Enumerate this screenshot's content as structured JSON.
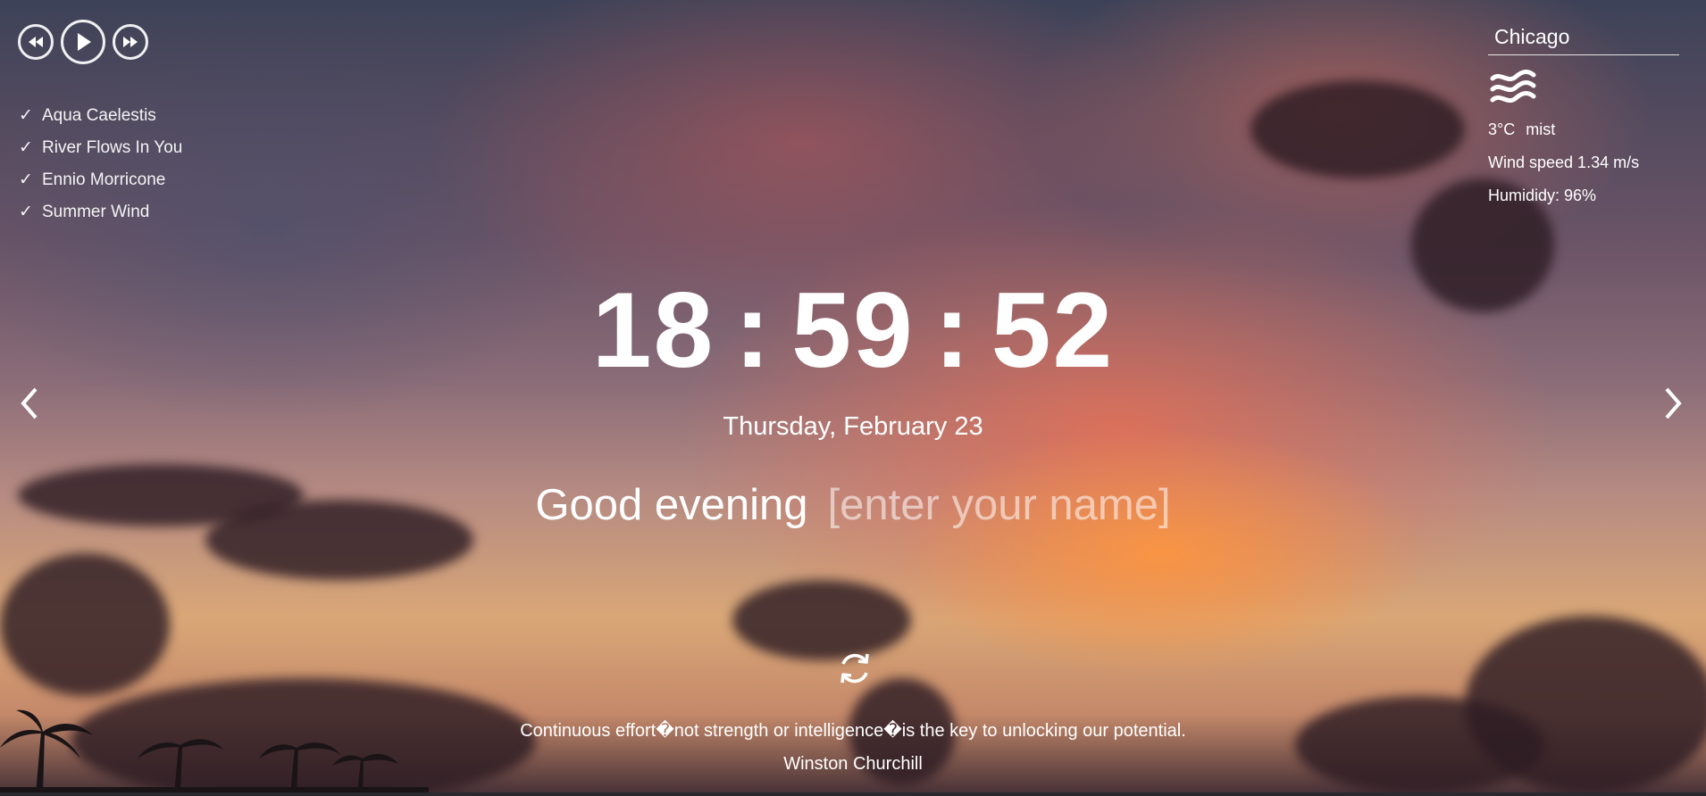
{
  "player": {
    "prev_icon": "rewind-icon",
    "play_icon": "play-icon",
    "next_icon": "fast-forward-icon"
  },
  "playlist": [
    {
      "title": "Aqua Caelestis",
      "icon": "check-icon"
    },
    {
      "title": "River Flows In You",
      "icon": "check-icon"
    },
    {
      "title": "Ennio Morricone",
      "icon": "check-icon"
    },
    {
      "title": "Summer Wind",
      "icon": "check-icon"
    }
  ],
  "weather": {
    "city": "Chicago",
    "icon": "mist-icon",
    "temperature": "3°C",
    "description": "mist",
    "wind": "Wind speed 1.34 m/s",
    "humidity": "Humididy: 96%"
  },
  "clock": {
    "hours": "18",
    "minutes": "59",
    "seconds": "52",
    "separator": ":"
  },
  "date": "Thursday, February 23",
  "greeting": {
    "text": "Good evening",
    "name_placeholder": "[enter your name]"
  },
  "quote": {
    "refresh_icon": "refresh-icon",
    "text": "Continuous effort�not strength or intelligence�is the key to unlocking our potential.",
    "author": "Winston Churchill"
  },
  "navigation": {
    "prev_icon": "chevron-left-icon",
    "next_icon": "chevron-right-icon"
  },
  "colors": {
    "text": "#ffffff",
    "placeholder": "rgba(255,255,255,0.55)"
  }
}
